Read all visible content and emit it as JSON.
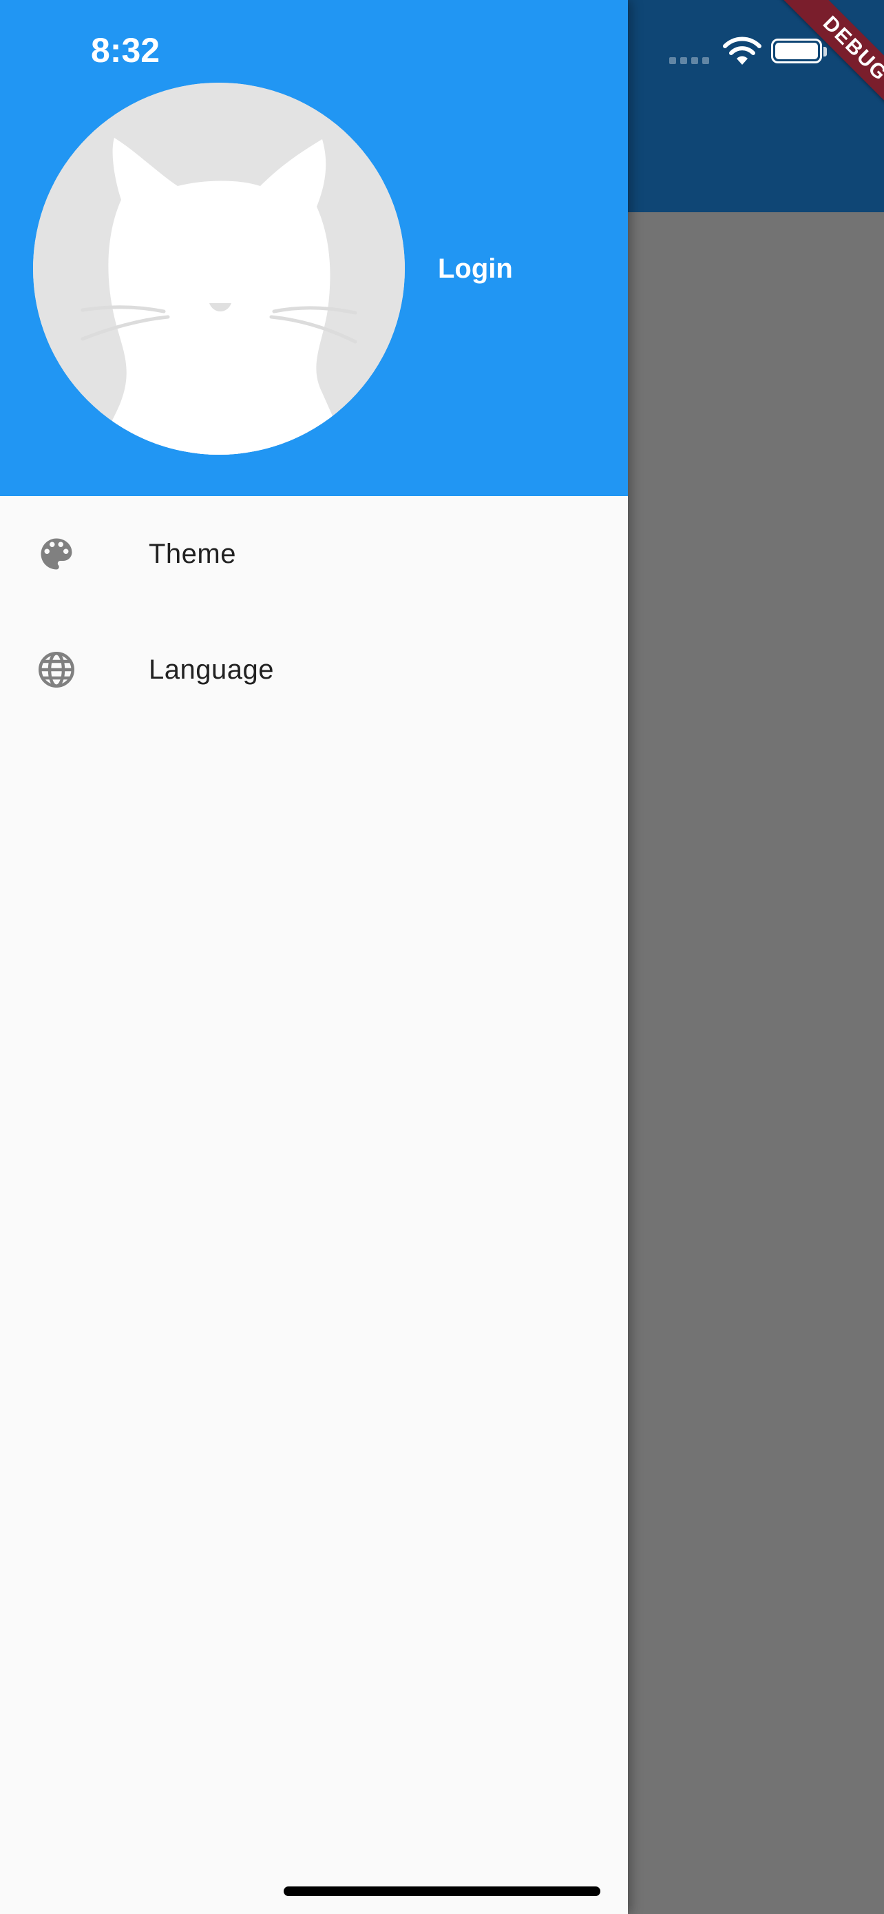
{
  "status_bar": {
    "time": "8:32",
    "signal_icon": "cellular-signal-icon",
    "wifi_icon": "wifi-icon",
    "battery_icon": "battery-icon"
  },
  "debug_banner": {
    "label": "DEBUG",
    "color": "#7a1e2c"
  },
  "drawer": {
    "header": {
      "background_color": "#2196f3",
      "avatar_icon": "cat-avatar-icon",
      "login_label": "Login"
    },
    "items": [
      {
        "icon": "palette-icon",
        "label": "Theme"
      },
      {
        "icon": "globe-icon",
        "label": "Language"
      }
    ]
  },
  "colors": {
    "app_bar": "#0f4675",
    "scrim_body": "#737373",
    "drawer_background": "#fafafa",
    "menu_icon": "#808080"
  }
}
